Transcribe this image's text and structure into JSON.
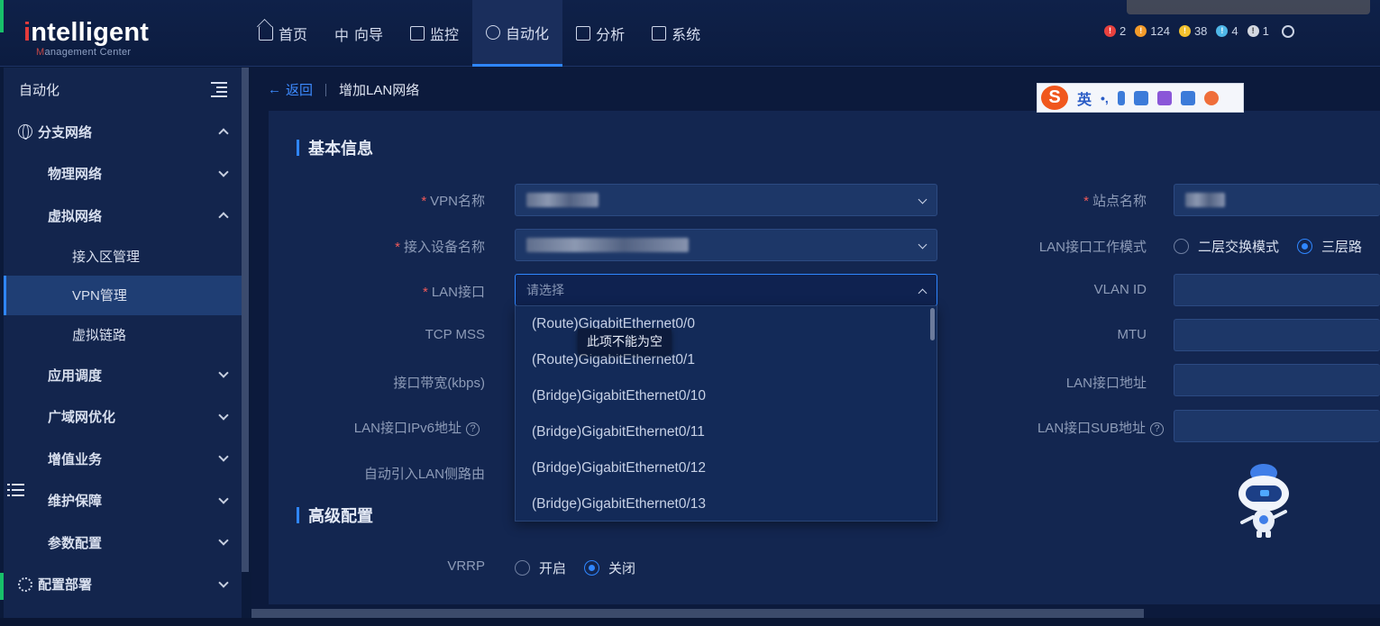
{
  "header": {
    "logo_main": "ntelligent",
    "logo_i": "i",
    "logo_sub_m": "M",
    "logo_sub_rest": "anagement Center",
    "nav": [
      {
        "label": "首页",
        "icon": "home-icon"
      },
      {
        "label": "向导",
        "icon": "guide-icon"
      },
      {
        "label": "监控",
        "icon": "monitor-icon"
      },
      {
        "label": "自动化",
        "icon": "gear-icon",
        "active": true
      },
      {
        "label": "分析",
        "icon": "chart-icon"
      },
      {
        "label": "系统",
        "icon": "system-icon"
      }
    ],
    "alarms": [
      {
        "count": "2",
        "color": "#e8413e",
        "glyph": "!"
      },
      {
        "count": "124",
        "color": "#f39b2a",
        "glyph": "!"
      },
      {
        "count": "38",
        "color": "#f2c12e",
        "glyph": "!"
      },
      {
        "count": "4",
        "color": "#4fb7e8",
        "glyph": "!"
      },
      {
        "count": "1",
        "color": "#d4d8e0",
        "glyph": "!"
      }
    ]
  },
  "sidebar": {
    "title": "自动化",
    "items": [
      {
        "label": "分支网络",
        "level": 0,
        "icon": "globe-icon",
        "chevron": "up"
      },
      {
        "label": "物理网络",
        "level": 1,
        "chevron": "down"
      },
      {
        "label": "虚拟网络",
        "level": 1,
        "chevron": "up"
      },
      {
        "label": "接入区管理",
        "level": 2
      },
      {
        "label": "VPN管理",
        "level": 2,
        "active": true
      },
      {
        "label": "虚拟链路",
        "level": 2
      },
      {
        "label": "应用调度",
        "level": 1,
        "chevron": "down"
      },
      {
        "label": "广域网优化",
        "level": 1,
        "chevron": "down"
      },
      {
        "label": "增值业务",
        "level": 1,
        "chevron": "down"
      },
      {
        "label": "维护保障",
        "level": 1,
        "chevron": "down"
      },
      {
        "label": "参数配置",
        "level": 1,
        "chevron": "down"
      },
      {
        "label": "配置部署",
        "level": 0,
        "icon": "cog-icon",
        "chevron": "down"
      }
    ]
  },
  "breadcrumb": {
    "back": "返回",
    "title": "增加LAN网络"
  },
  "form": {
    "basic_title": "基本信息",
    "advanced_title": "高级配置",
    "labels": {
      "vpn_name": "VPN名称",
      "device_name": "接入设备名称",
      "lan_interface": "LAN接口",
      "tcp_mss": "TCP MSS",
      "bandwidth": "接口带宽(kbps)",
      "ipv6": "LAN接口IPv6地址",
      "auto_route": "自动引入LAN侧路由",
      "site_name": "站点名称",
      "work_mode": "LAN接口工作模式",
      "vlan_id": "VLAN ID",
      "mtu": "MTU",
      "lan_addr": "LAN接口地址",
      "sub_addr": "LAN接口SUB地址",
      "vrrp": "VRRP"
    },
    "help_glyph": "?",
    "lan_placeholder": "请选择",
    "work_mode_options": [
      "二层交换模式",
      "三层路"
    ],
    "work_mode_selected": "三层路",
    "vrrp_options": [
      "开启",
      "关闭"
    ],
    "vrrp_selected": "关闭",
    "dropdown_options": [
      "(Route)GigabitEthernet0/0",
      "(Route)GigabitEthernet0/1",
      "(Bridge)GigabitEthernet0/10",
      "(Bridge)GigabitEthernet0/11",
      "(Bridge)GigabitEthernet0/12",
      "(Bridge)GigabitEthernet0/13"
    ],
    "tooltip": "此项不能为空"
  },
  "ime": {
    "logo": "S",
    "mode": "英",
    "punct": "•,"
  }
}
